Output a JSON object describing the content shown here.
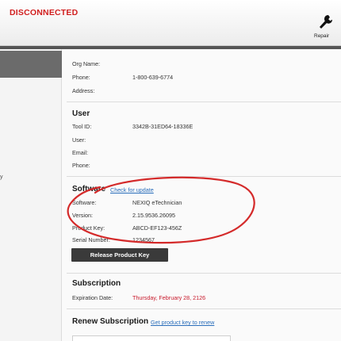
{
  "header": {
    "status": "DISCONNECTED",
    "repair_label": "Repair"
  },
  "sidebar": {
    "fragment": "y"
  },
  "org": {
    "fields": [
      {
        "label": "Org Name:",
        "value": ""
      },
      {
        "label": "Phone:",
        "value": "1-800-639-6774"
      },
      {
        "label": "Address:",
        "value": ""
      }
    ]
  },
  "user": {
    "title": "User",
    "fields": [
      {
        "label": "Tool ID:",
        "value": "3342B-31ED64-18336E"
      },
      {
        "label": "User:",
        "value": ""
      },
      {
        "label": "Email:",
        "value": ""
      },
      {
        "label": "Phone:",
        "value": ""
      }
    ]
  },
  "software": {
    "title": "Software",
    "update_link": "Check for update",
    "fields": [
      {
        "label": "Software:",
        "value": "NEXIQ eTechnician"
      },
      {
        "label": "Version:",
        "value": "2.15.9536.26095"
      },
      {
        "label": "Product Key:",
        "value": "ABCD-EF123-456Z"
      },
      {
        "label": "Serial Number:",
        "value": "1234567"
      }
    ],
    "release_button": "Release Product Key"
  },
  "subscription": {
    "title": "Subscription",
    "expiration_label": "Expiration Date:",
    "expiration_value": "Thursday, February 28, 2126"
  },
  "renew": {
    "title": "Renew Subscription",
    "link": "Get product key to renew",
    "input_placeholder": ""
  },
  "colors": {
    "disconnected": "#d11f1f",
    "expiration": "#c8192b",
    "link": "#2a6ebb",
    "annotation_circle": "#d42a2a"
  }
}
